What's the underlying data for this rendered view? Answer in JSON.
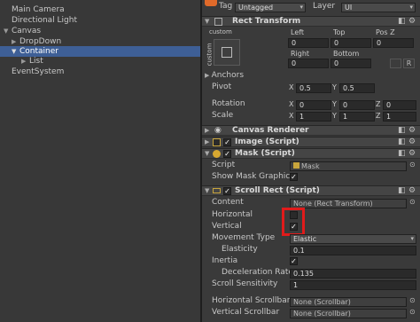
{
  "hierarchy": {
    "items": [
      "Main Camera",
      "Directional Light",
      "Canvas",
      "DropDown",
      "Container",
      "List",
      "EventSystem"
    ]
  },
  "inspector": {
    "tag_label": "Tag",
    "tag_value": "Untagged",
    "layer_label": "Layer",
    "layer_value": "UI",
    "rect_transform": {
      "title": "Rect Transform",
      "anchor_preset_label": "custom",
      "anchor_side_label": "custom",
      "left_label": "Left",
      "top_label": "Top",
      "posz_label": "Pos Z",
      "left": "0",
      "top": "0",
      "posz": "0",
      "right_label": "Right",
      "bottom_label": "Bottom",
      "right": "0",
      "bottom": "0",
      "anchors_label": "Anchors",
      "pivot_label": "Pivot",
      "pivot_x_label": "X",
      "pivot_x": "0.5",
      "pivot_y_label": "Y",
      "pivot_y": "0.5",
      "rotation_label": "Rotation",
      "rot_x_label": "X",
      "rot_x": "0",
      "rot_y_label": "Y",
      "rot_y": "0",
      "rot_z_label": "Z",
      "rot_z": "0",
      "scale_label": "Scale",
      "scale_x_label": "X",
      "scale_x": "1",
      "scale_y_label": "Y",
      "scale_y": "1",
      "scale_z_label": "Z",
      "scale_z": "1",
      "r_button": "R"
    },
    "canvas_renderer": {
      "title": "Canvas Renderer"
    },
    "image_script": {
      "title": "Image (Script)"
    },
    "mask_script": {
      "title": "Mask (Script)",
      "script_label": "Script",
      "script_value": "Mask",
      "show_mask_graphic_label": "Show Mask Graphic",
      "show_mask_graphic": true
    },
    "scroll_rect": {
      "title": "Scroll Rect (Script)",
      "content_label": "Content",
      "content_value": "None (Rect Transform)",
      "horizontal_label": "Horizontal",
      "horizontal": false,
      "vertical_label": "Vertical",
      "vertical": true,
      "movement_type_label": "Movement Type",
      "movement_type_value": "Elastic",
      "elasticity_label": "Elasticity",
      "elasticity_value": "0.1",
      "inertia_label": "Inertia",
      "inertia": true,
      "deceleration_label": "Deceleration Rate",
      "deceleration_value": "0.135",
      "scroll_sensitivity_label": "Scroll Sensitivity",
      "scroll_sensitivity_value": "1",
      "h_scrollbar_label": "Horizontal Scrollbar",
      "h_scrollbar_value": "None (Scrollbar)",
      "v_scrollbar_label": "Vertical Scrollbar",
      "v_scrollbar_value": "None (Scrollbar)"
    }
  },
  "colors": {
    "selection": "#3e5f96",
    "highlight_box": "#e01b1b",
    "panel": "#3a3a3a",
    "header": "#454545"
  },
  "icons": [
    "unity-cube-icon",
    "gear-icon",
    "fold-arrow-icon",
    "eye-icon",
    "image-icon",
    "mask-icon",
    "scroll-rect-icon",
    "object-picker-icon",
    "reference-icon",
    "anchor-preset-icon"
  ]
}
